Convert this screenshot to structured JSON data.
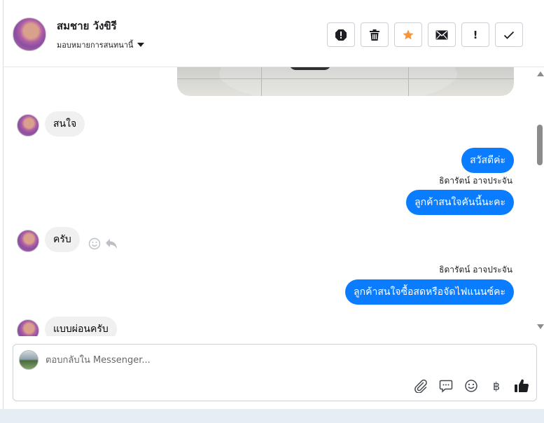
{
  "header": {
    "contact_name": "สมชาย วังขิรี",
    "assign_label": "มอบหมายการสนทนานี้",
    "actions": [
      {
        "name": "spam-button",
        "icon": "alert-octagon-icon"
      },
      {
        "name": "delete-button",
        "icon": "trash-icon"
      },
      {
        "name": "star-button",
        "icon": "star-icon",
        "color": "#f5943a"
      },
      {
        "name": "mark-unread-button",
        "icon": "envelope-icon"
      },
      {
        "name": "follow-up-button",
        "icon": "exclamation-icon",
        "label": "!"
      },
      {
        "name": "mark-done-button",
        "icon": "check-icon"
      }
    ]
  },
  "thread": {
    "messages": [
      {
        "direction": "in",
        "text": "สนใจ"
      },
      {
        "direction": "out",
        "text": "สวัสดีค่ะ"
      },
      {
        "direction": "out",
        "sender": "ธิดารัตน์ อาจประจัน",
        "text": "ลูกค้าสนใจคันนี้นะคะ"
      },
      {
        "direction": "in",
        "text": "ครับ"
      },
      {
        "direction": "out",
        "sender": "ธิดารัตน์ อาจประจัน",
        "text": "ลูกค้าสนใจซื้อสดหรือจัดไฟแนนซ์คะ"
      },
      {
        "direction": "in",
        "text": "แบบผ่อนครับ"
      }
    ],
    "colors": {
      "outgoing": "#0a7cff",
      "incoming": "#f0f0f0"
    }
  },
  "composer": {
    "placeholder": "ตอบกลับใน Messenger...",
    "tools": [
      "paperclip-icon",
      "speech-bubble-icon",
      "emoji-icon",
      "baht-icon",
      "thumbs-up-icon"
    ],
    "baht_symbol": "฿"
  }
}
